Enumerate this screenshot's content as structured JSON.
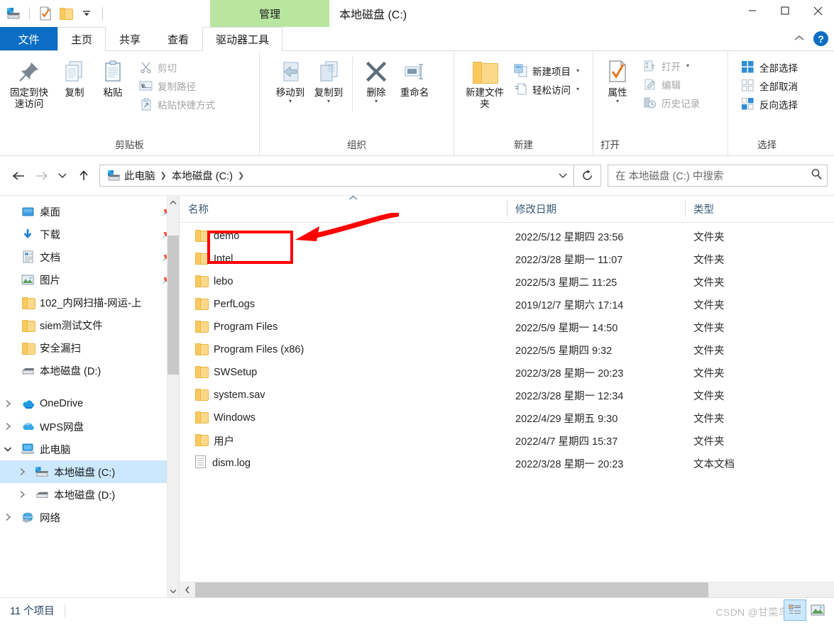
{
  "window": {
    "title": "本地磁盘 (C:)",
    "contextual_tab": "管理",
    "minimize": "—",
    "maximize": "▢",
    "close": "✕"
  },
  "quick_access_toolbar": {
    "items": [
      {
        "icon": "drive-icon",
        "name": "drive-properties"
      },
      {
        "icon": "properties-icon",
        "name": "properties"
      },
      {
        "icon": "new-folder-icon",
        "name": "new-folder"
      },
      {
        "icon": "chevron-down-icon",
        "name": "customize-qat"
      }
    ]
  },
  "ribbon": {
    "tabs": [
      {
        "label": "文件",
        "name": "tab-file"
      },
      {
        "label": "主页",
        "name": "tab-home",
        "active": true
      },
      {
        "label": "共享",
        "name": "tab-share"
      },
      {
        "label": "查看",
        "name": "tab-view"
      },
      {
        "label": "驱动器工具",
        "name": "tab-drive-tools"
      }
    ],
    "collapse_icon": "⌃",
    "help_icon": "?",
    "groups": [
      {
        "name": "clipboard",
        "label": "剪贴板",
        "big_buttons": [
          {
            "label": "固定到快速访问",
            "icon": "pin-icon"
          },
          {
            "label": "复制",
            "icon": "copy-icon"
          },
          {
            "label": "粘贴",
            "icon": "paste-icon"
          }
        ],
        "small_buttons": [
          {
            "label": "剪切",
            "icon": "scissors-icon",
            "disabled": true
          },
          {
            "label": "复制路径",
            "icon": "copy-path-icon",
            "disabled": true
          },
          {
            "label": "粘贴快捷方式",
            "icon": "paste-shortcut-icon",
            "disabled": true
          }
        ]
      },
      {
        "name": "organize",
        "label": "组织",
        "big_buttons": [
          {
            "label": "移动到",
            "icon": "move-to-icon",
            "has_caret": true
          },
          {
            "label": "复制到",
            "icon": "copy-to-icon",
            "has_caret": true
          },
          {
            "label": "删除",
            "icon": "delete-icon",
            "has_caret": true
          },
          {
            "label": "重命名",
            "icon": "rename-icon"
          }
        ]
      },
      {
        "name": "new",
        "label": "新建",
        "big_buttons": [
          {
            "label": "新建文件夹",
            "icon": "new-folder-icon"
          }
        ],
        "small_buttons": [
          {
            "label": "新建项目",
            "icon": "new-item-icon",
            "has_caret": true
          },
          {
            "label": "轻松访问",
            "icon": "easy-access-icon",
            "has_caret": true
          }
        ]
      },
      {
        "name": "open",
        "label": "打开",
        "big_buttons": [
          {
            "label": "属性",
            "icon": "properties-icon",
            "has_caret": true
          }
        ],
        "small_buttons": [
          {
            "label": "打开",
            "icon": "open-icon",
            "has_caret": true,
            "disabled": true
          },
          {
            "label": "编辑",
            "icon": "edit-icon",
            "disabled": true
          },
          {
            "label": "历史记录",
            "icon": "history-icon",
            "disabled": true
          }
        ]
      },
      {
        "name": "select",
        "label": "选择",
        "small_buttons": [
          {
            "label": "全部选择",
            "icon": "select-all-icon"
          },
          {
            "label": "全部取消",
            "icon": "select-none-icon"
          },
          {
            "label": "反向选择",
            "icon": "invert-selection-icon"
          }
        ]
      }
    ]
  },
  "navbar": {
    "back_icon": "←",
    "forward_icon": "→",
    "recent_icon": "⌄",
    "up_icon": "↑",
    "breadcrumbs": [
      {
        "label": "此电脑",
        "icon": "this-pc-icon"
      },
      {
        "label": "本地磁盘 (C:)"
      }
    ],
    "breadcrumb_dropdown_icon": "⌄",
    "refresh_icon": "↻",
    "search_placeholder": "在 本地磁盘 (C:) 中搜索",
    "search_value": "",
    "search_icon": "🔍"
  },
  "nav_pane": {
    "quick_access_items": [
      {
        "label": "桌面",
        "icon": "desktop-icon",
        "pinned": true
      },
      {
        "label": "下载",
        "icon": "downloads-icon",
        "pinned": true
      },
      {
        "label": "文档",
        "icon": "documents-icon",
        "pinned": true
      },
      {
        "label": "图片",
        "icon": "pictures-icon",
        "pinned": true
      },
      {
        "label": "102_内网扫描-网运-上",
        "icon": "folder-icon",
        "pinned": false
      },
      {
        "label": "siem测试文件",
        "icon": "folder-icon",
        "pinned": false
      },
      {
        "label": "安全漏扫",
        "icon": "folder-icon",
        "pinned": false
      },
      {
        "label": "本地磁盘 (D:)",
        "icon": "drive-icon",
        "pinned": false
      }
    ],
    "tree_items": [
      {
        "label": "OneDrive",
        "icon": "onedrive-icon",
        "expander": "›",
        "indent": 0
      },
      {
        "label": "WPS网盘",
        "icon": "wps-cloud-icon",
        "expander": "›",
        "indent": 0
      },
      {
        "label": "此电脑",
        "icon": "this-pc-icon",
        "expander": "⌄",
        "indent": 0
      },
      {
        "label": "本地磁盘 (C:)",
        "icon": "windows-drive-icon",
        "expander": "›",
        "indent": 1,
        "selected": true
      },
      {
        "label": "本地磁盘 (D:)",
        "icon": "drive-icon",
        "expander": "›",
        "indent": 1
      },
      {
        "label": "网络",
        "icon": "network-icon",
        "expander": "›",
        "indent": 0
      }
    ],
    "scroll_up_icon": "⌃",
    "scroll_down_icon": "⌄"
  },
  "file_list": {
    "columns": [
      {
        "label": "名称",
        "name": "column-name",
        "sorted": true,
        "sort_icon": "⌃"
      },
      {
        "label": "修改日期",
        "name": "column-date-modified"
      },
      {
        "label": "类型",
        "name": "column-type"
      }
    ],
    "rows": [
      {
        "name": "demo",
        "date": "2022/5/12 星期四 23:56",
        "type": "文件夹",
        "icon": "folder-icon",
        "highlighted": true
      },
      {
        "name": "Intel",
        "date": "2022/3/28 星期一 11:07",
        "type": "文件夹",
        "icon": "folder-icon"
      },
      {
        "name": "lebo",
        "date": "2022/5/3 星期二 11:25",
        "type": "文件夹",
        "icon": "folder-icon"
      },
      {
        "name": "PerfLogs",
        "date": "2019/12/7 星期六 17:14",
        "type": "文件夹",
        "icon": "folder-icon"
      },
      {
        "name": "Program Files",
        "date": "2022/5/9 星期一 14:50",
        "type": "文件夹",
        "icon": "folder-icon"
      },
      {
        "name": "Program Files (x86)",
        "date": "2022/5/5 星期四 9:32",
        "type": "文件夹",
        "icon": "folder-icon"
      },
      {
        "name": "SWSetup",
        "date": "2022/3/28 星期一 20:23",
        "type": "文件夹",
        "icon": "folder-icon"
      },
      {
        "name": "system.sav",
        "date": "2022/3/28 星期一 12:34",
        "type": "文件夹",
        "icon": "folder-icon"
      },
      {
        "name": "Windows",
        "date": "2022/4/29 星期五 9:30",
        "type": "文件夹",
        "icon": "folder-icon"
      },
      {
        "name": "用户",
        "date": "2022/4/7 星期四 15:37",
        "type": "文件夹",
        "icon": "folder-icon"
      },
      {
        "name": "dism.log",
        "date": "2022/3/28 星期一 20:23",
        "type": "文本文档",
        "icon": "text-file-icon"
      }
    ],
    "hscroll_left_icon": "‹"
  },
  "status_bar": {
    "item_count": "11 个项目",
    "watermark": "CSDN @甘菜鸟",
    "view_details_icon": "details-view-icon",
    "view_thumbnails_icon": "thumbnails-view-icon"
  },
  "annotations": {
    "highlight_target": "demo",
    "color": "#ff0000"
  }
}
